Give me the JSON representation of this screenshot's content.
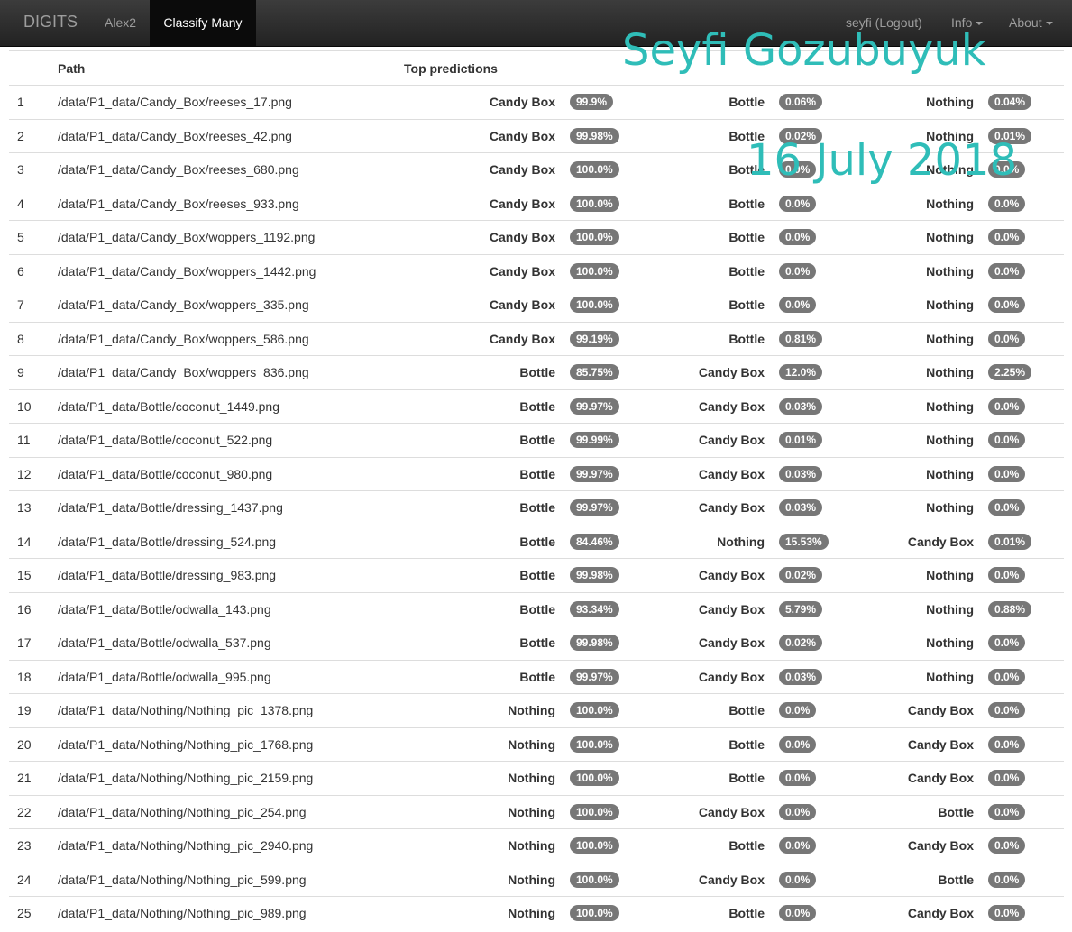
{
  "navbar": {
    "brand": "DIGITS",
    "links": [
      "Alex2",
      "Classify Many"
    ],
    "user": "seyfi (Logout)",
    "info": "Info",
    "about": "About"
  },
  "table": {
    "headers": [
      "",
      "Path",
      "Top predictions"
    ],
    "rows": [
      {
        "idx": "1",
        "path": "/data/P1_data/Candy_Box/reeses_17.png",
        "preds": [
          [
            "Candy Box",
            "99.9%"
          ],
          [
            "Bottle",
            "0.06%"
          ],
          [
            "Nothing",
            "0.04%"
          ]
        ]
      },
      {
        "idx": "2",
        "path": "/data/P1_data/Candy_Box/reeses_42.png",
        "preds": [
          [
            "Candy Box",
            "99.98%"
          ],
          [
            "Bottle",
            "0.02%"
          ],
          [
            "Nothing",
            "0.01%"
          ]
        ]
      },
      {
        "idx": "3",
        "path": "/data/P1_data/Candy_Box/reeses_680.png",
        "preds": [
          [
            "Candy Box",
            "100.0%"
          ],
          [
            "Bottle",
            "0.0%"
          ],
          [
            "Nothing",
            "0.0%"
          ]
        ]
      },
      {
        "idx": "4",
        "path": "/data/P1_data/Candy_Box/reeses_933.png",
        "preds": [
          [
            "Candy Box",
            "100.0%"
          ],
          [
            "Bottle",
            "0.0%"
          ],
          [
            "Nothing",
            "0.0%"
          ]
        ]
      },
      {
        "idx": "5",
        "path": "/data/P1_data/Candy_Box/woppers_1192.png",
        "preds": [
          [
            "Candy Box",
            "100.0%"
          ],
          [
            "Bottle",
            "0.0%"
          ],
          [
            "Nothing",
            "0.0%"
          ]
        ]
      },
      {
        "idx": "6",
        "path": "/data/P1_data/Candy_Box/woppers_1442.png",
        "preds": [
          [
            "Candy Box",
            "100.0%"
          ],
          [
            "Bottle",
            "0.0%"
          ],
          [
            "Nothing",
            "0.0%"
          ]
        ]
      },
      {
        "idx": "7",
        "path": "/data/P1_data/Candy_Box/woppers_335.png",
        "preds": [
          [
            "Candy Box",
            "100.0%"
          ],
          [
            "Bottle",
            "0.0%"
          ],
          [
            "Nothing",
            "0.0%"
          ]
        ]
      },
      {
        "idx": "8",
        "path": "/data/P1_data/Candy_Box/woppers_586.png",
        "preds": [
          [
            "Candy Box",
            "99.19%"
          ],
          [
            "Bottle",
            "0.81%"
          ],
          [
            "Nothing",
            "0.0%"
          ]
        ]
      },
      {
        "idx": "9",
        "path": "/data/P1_data/Candy_Box/woppers_836.png",
        "preds": [
          [
            "Bottle",
            "85.75%"
          ],
          [
            "Candy Box",
            "12.0%"
          ],
          [
            "Nothing",
            "2.25%"
          ]
        ]
      },
      {
        "idx": "10",
        "path": "/data/P1_data/Bottle/coconut_1449.png",
        "preds": [
          [
            "Bottle",
            "99.97%"
          ],
          [
            "Candy Box",
            "0.03%"
          ],
          [
            "Nothing",
            "0.0%"
          ]
        ]
      },
      {
        "idx": "11",
        "path": "/data/P1_data/Bottle/coconut_522.png",
        "preds": [
          [
            "Bottle",
            "99.99%"
          ],
          [
            "Candy Box",
            "0.01%"
          ],
          [
            "Nothing",
            "0.0%"
          ]
        ]
      },
      {
        "idx": "12",
        "path": "/data/P1_data/Bottle/coconut_980.png",
        "preds": [
          [
            "Bottle",
            "99.97%"
          ],
          [
            "Candy Box",
            "0.03%"
          ],
          [
            "Nothing",
            "0.0%"
          ]
        ]
      },
      {
        "idx": "13",
        "path": "/data/P1_data/Bottle/dressing_1437.png",
        "preds": [
          [
            "Bottle",
            "99.97%"
          ],
          [
            "Candy Box",
            "0.03%"
          ],
          [
            "Nothing",
            "0.0%"
          ]
        ]
      },
      {
        "idx": "14",
        "path": "/data/P1_data/Bottle/dressing_524.png",
        "preds": [
          [
            "Bottle",
            "84.46%"
          ],
          [
            "Nothing",
            "15.53%"
          ],
          [
            "Candy Box",
            "0.01%"
          ]
        ]
      },
      {
        "idx": "15",
        "path": "/data/P1_data/Bottle/dressing_983.png",
        "preds": [
          [
            "Bottle",
            "99.98%"
          ],
          [
            "Candy Box",
            "0.02%"
          ],
          [
            "Nothing",
            "0.0%"
          ]
        ]
      },
      {
        "idx": "16",
        "path": "/data/P1_data/Bottle/odwalla_143.png",
        "preds": [
          [
            "Bottle",
            "93.34%"
          ],
          [
            "Candy Box",
            "5.79%"
          ],
          [
            "Nothing",
            "0.88%"
          ]
        ]
      },
      {
        "idx": "17",
        "path": "/data/P1_data/Bottle/odwalla_537.png",
        "preds": [
          [
            "Bottle",
            "99.98%"
          ],
          [
            "Candy Box",
            "0.02%"
          ],
          [
            "Nothing",
            "0.0%"
          ]
        ]
      },
      {
        "idx": "18",
        "path": "/data/P1_data/Bottle/odwalla_995.png",
        "preds": [
          [
            "Bottle",
            "99.97%"
          ],
          [
            "Candy Box",
            "0.03%"
          ],
          [
            "Nothing",
            "0.0%"
          ]
        ]
      },
      {
        "idx": "19",
        "path": "/data/P1_data/Nothing/Nothing_pic_1378.png",
        "preds": [
          [
            "Nothing",
            "100.0%"
          ],
          [
            "Bottle",
            "0.0%"
          ],
          [
            "Candy Box",
            "0.0%"
          ]
        ]
      },
      {
        "idx": "20",
        "path": "/data/P1_data/Nothing/Nothing_pic_1768.png",
        "preds": [
          [
            "Nothing",
            "100.0%"
          ],
          [
            "Bottle",
            "0.0%"
          ],
          [
            "Candy Box",
            "0.0%"
          ]
        ]
      },
      {
        "idx": "21",
        "path": "/data/P1_data/Nothing/Nothing_pic_2159.png",
        "preds": [
          [
            "Nothing",
            "100.0%"
          ],
          [
            "Bottle",
            "0.0%"
          ],
          [
            "Candy Box",
            "0.0%"
          ]
        ]
      },
      {
        "idx": "22",
        "path": "/data/P1_data/Nothing/Nothing_pic_254.png",
        "preds": [
          [
            "Nothing",
            "100.0%"
          ],
          [
            "Candy Box",
            "0.0%"
          ],
          [
            "Bottle",
            "0.0%"
          ]
        ]
      },
      {
        "idx": "23",
        "path": "/data/P1_data/Nothing/Nothing_pic_2940.png",
        "preds": [
          [
            "Nothing",
            "100.0%"
          ],
          [
            "Bottle",
            "0.0%"
          ],
          [
            "Candy Box",
            "0.0%"
          ]
        ]
      },
      {
        "idx": "24",
        "path": "/data/P1_data/Nothing/Nothing_pic_599.png",
        "preds": [
          [
            "Nothing",
            "100.0%"
          ],
          [
            "Candy Box",
            "0.0%"
          ],
          [
            "Bottle",
            "0.0%"
          ]
        ]
      },
      {
        "idx": "25",
        "path": "/data/P1_data/Nothing/Nothing_pic_989.png",
        "preds": [
          [
            "Nothing",
            "100.0%"
          ],
          [
            "Bottle",
            "0.0%"
          ],
          [
            "Candy Box",
            "0.0%"
          ]
        ]
      }
    ]
  },
  "watermark": {
    "name": "Seyfi Gozubuyuk",
    "date": "16 July 2018"
  },
  "colors": {
    "navbar": "#222222",
    "badge": "#777777",
    "watermark": "#2fbdb8"
  }
}
